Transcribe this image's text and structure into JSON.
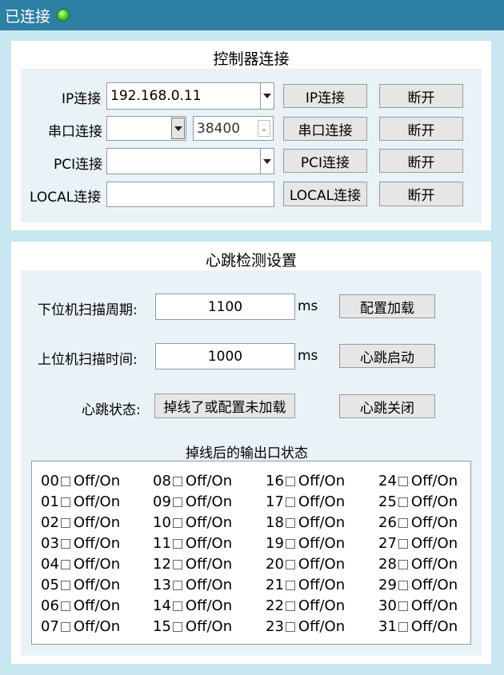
{
  "status": {
    "text": "已连接",
    "led_color": "#4fd22a"
  },
  "controller": {
    "title": "控制器连接",
    "ip": {
      "label": "IP连接",
      "value": "192.168.0.11",
      "connect": "IP连接",
      "disconnect": "断开"
    },
    "serial": {
      "label": "串口连接",
      "port": "",
      "baud": "38400",
      "connect": "串口连接",
      "disconnect": "断开"
    },
    "pci": {
      "label": "PCI连接",
      "value": "",
      "connect": "PCI连接",
      "disconnect": "断开"
    },
    "local": {
      "label": "LOCAL连接",
      "value": "",
      "connect": "LOCAL连接",
      "disconnect": "断开"
    }
  },
  "heartbeat": {
    "title": "心跳检测设置",
    "lower_label": "下位机扫描周期:",
    "lower_value": "1100",
    "unit1": "ms",
    "load_btn": "配置加载",
    "upper_label": "上位机扫描时间:",
    "upper_value": "1000",
    "unit2": "ms",
    "start_btn": "心跳启动",
    "state_label": "心跳状态:",
    "state_value": "掉线了或配置未加载",
    "stop_btn": "心跳关闭",
    "outputs_title": "掉线后的输出口状态",
    "outputs": [
      {
        "num": "00",
        "text": "Off/On"
      },
      {
        "num": "01",
        "text": "Off/On"
      },
      {
        "num": "02",
        "text": "Off/On"
      },
      {
        "num": "03",
        "text": "Off/On"
      },
      {
        "num": "04",
        "text": "Off/On"
      },
      {
        "num": "05",
        "text": "Off/On"
      },
      {
        "num": "06",
        "text": "Off/On"
      },
      {
        "num": "07",
        "text": "Off/On"
      },
      {
        "num": "08",
        "text": "Off/On"
      },
      {
        "num": "09",
        "text": "Off/On"
      },
      {
        "num": "10",
        "text": "Off/On"
      },
      {
        "num": "11",
        "text": "Off/On"
      },
      {
        "num": "12",
        "text": "Off/On"
      },
      {
        "num": "13",
        "text": "Off/On"
      },
      {
        "num": "14",
        "text": "Off/On"
      },
      {
        "num": "15",
        "text": "Off/On"
      },
      {
        "num": "16",
        "text": "Off/On"
      },
      {
        "num": "17",
        "text": "Off/On"
      },
      {
        "num": "18",
        "text": "Off/On"
      },
      {
        "num": "19",
        "text": "Off/On"
      },
      {
        "num": "20",
        "text": "Off/On"
      },
      {
        "num": "21",
        "text": "Off/On"
      },
      {
        "num": "22",
        "text": "Off/On"
      },
      {
        "num": "23",
        "text": "Off/On"
      },
      {
        "num": "24",
        "text": "Off/On"
      },
      {
        "num": "25",
        "text": "Off/On"
      },
      {
        "num": "26",
        "text": "Off/On"
      },
      {
        "num": "27",
        "text": "Off/On"
      },
      {
        "num": "28",
        "text": "Off/On"
      },
      {
        "num": "29",
        "text": "Off/On"
      },
      {
        "num": "30",
        "text": "Off/On"
      },
      {
        "num": "31",
        "text": "Off/On"
      }
    ]
  }
}
